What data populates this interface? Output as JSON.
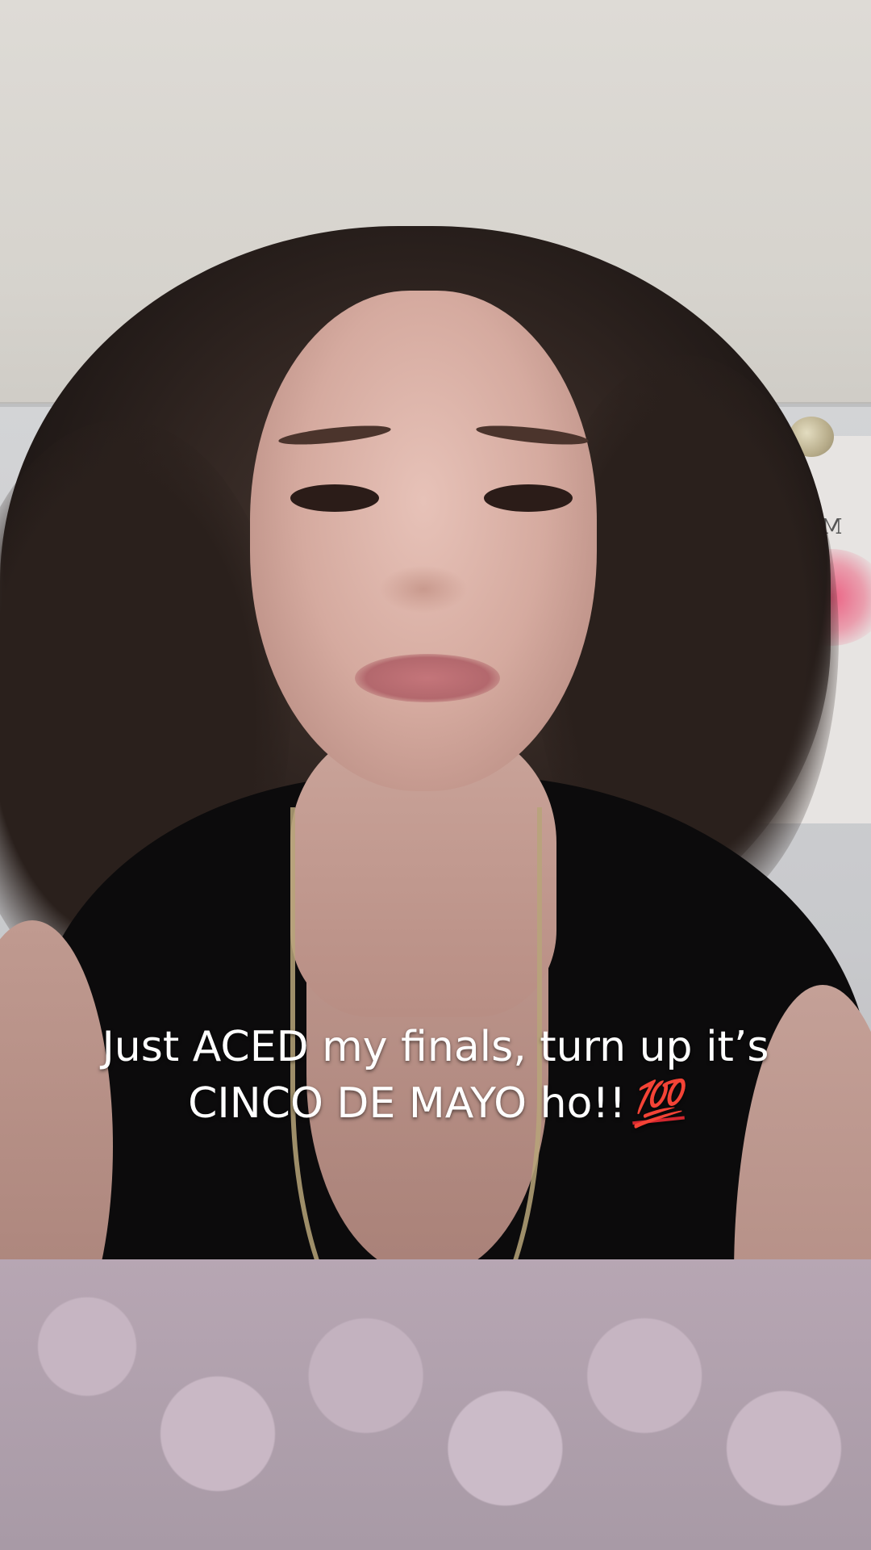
{
  "caption": {
    "line1": "Just ACED my finals, turn up it’s",
    "line2": "CINCO DE MAYO ho!!",
    "emoji": "💯"
  },
  "background": {
    "poster_text": "MIND"
  }
}
